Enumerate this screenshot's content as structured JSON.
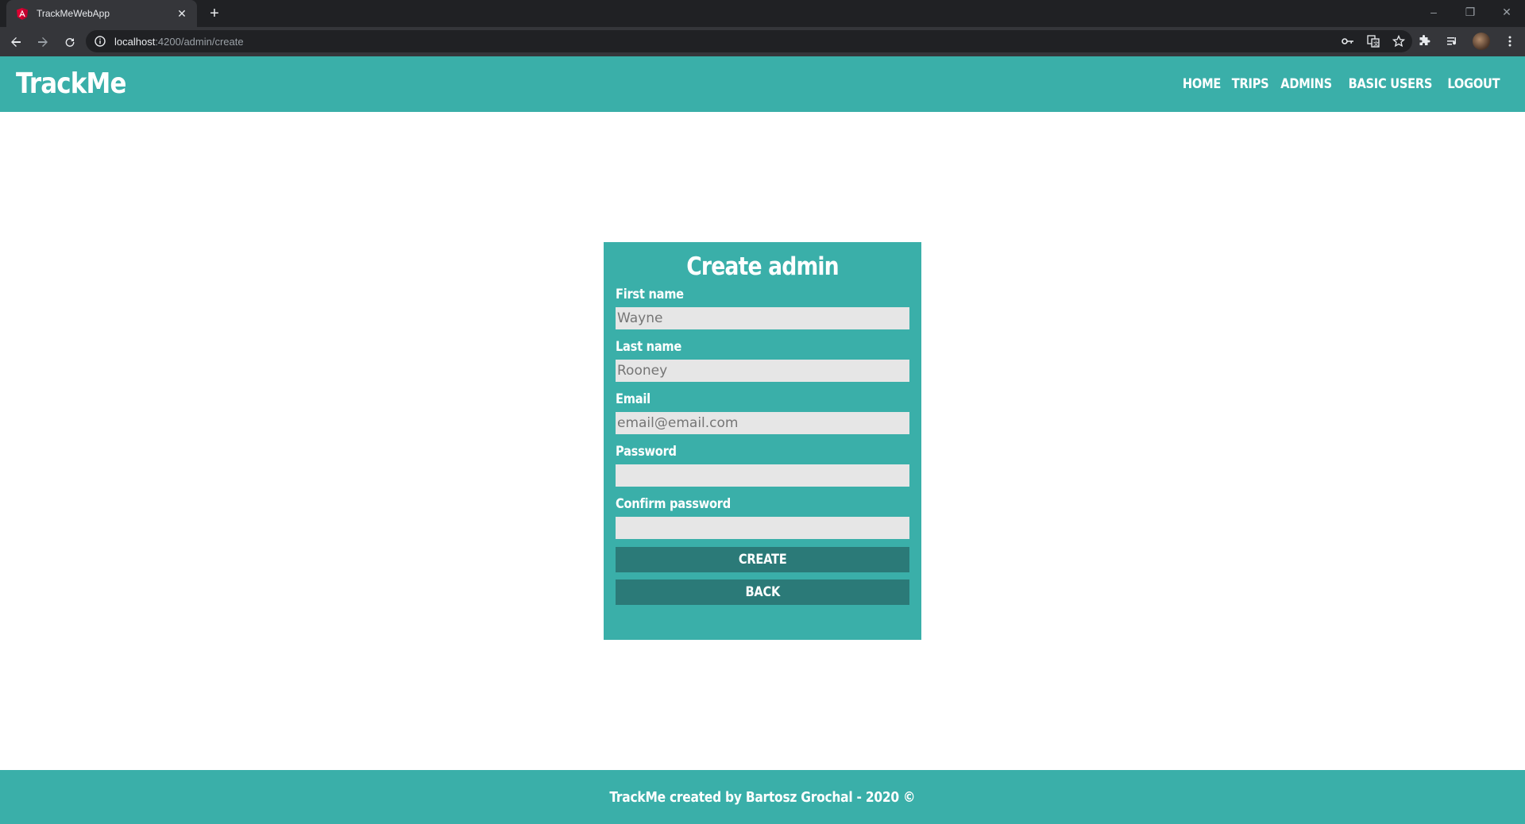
{
  "browser": {
    "tab_title": "TrackMeWebApp",
    "tab_close": "✕",
    "new_tab": "+",
    "url_host": "localhost",
    "url_path": ":4200/admin/create",
    "window_controls": {
      "minimize": "–",
      "restore": "❐",
      "close": "✕"
    }
  },
  "header": {
    "brand": "TrackMe",
    "nav": [
      "HOME",
      "TRIPS",
      "ADMINS",
      "BASIC USERS",
      "LOGOUT"
    ]
  },
  "form": {
    "title": "Create admin",
    "fields": [
      {
        "label": "First name",
        "value": "",
        "placeholder": "Wayne"
      },
      {
        "label": "Last name",
        "value": "",
        "placeholder": "Rooney"
      },
      {
        "label": "Email",
        "value": "",
        "placeholder": "email@email.com"
      },
      {
        "label": "Password",
        "value": "",
        "placeholder": ""
      },
      {
        "label": "Confirm password",
        "value": "",
        "placeholder": ""
      }
    ],
    "create_label": "CREATE",
    "back_label": "BACK"
  },
  "footer": {
    "text": "TrackMe created by Bartosz Grochal - 2020 ©"
  },
  "colors": {
    "primary": "#3aafa9",
    "button": "#2b7a78",
    "input_bg": "#e6e6e6",
    "chrome_dark": "#202124",
    "chrome_mid": "#35363a"
  }
}
